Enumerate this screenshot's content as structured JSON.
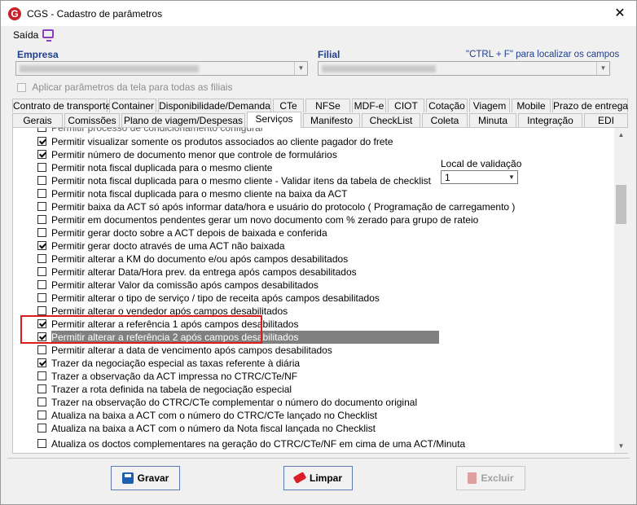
{
  "window": {
    "title": "CGS - Cadastro de parâmetros",
    "close_glyph": "✕",
    "logo_letter": "G"
  },
  "menu": {
    "saida": "Saída"
  },
  "filters": {
    "empresa_label": "Empresa",
    "filial_label": "Filial",
    "hint": "\"CTRL + F\" para localizar os campos",
    "apply_all_label": "Aplicar parâmetros da tela para todas as filiais"
  },
  "tabs_row1": [
    "Contrato de transporte",
    "Container",
    "Disponibilidade/Demanda",
    "CTe",
    "NFSe",
    "MDF-e",
    "CIOT",
    "Cotação",
    "Viagem",
    "Mobile",
    "Prazo de entrega"
  ],
  "tabs_row2": [
    "Gerais",
    "Comissões",
    "Plano de viagem/Despesas",
    "Serviços",
    "Manifesto",
    "CheckList",
    "Coleta",
    "Minuta",
    "Integração",
    "EDI"
  ],
  "active_tab": "Serviços",
  "items": [
    {
      "label": "Permitir processo de condicionamento configurar",
      "checked": false
    },
    {
      "label": "Permitir visualizar somente os produtos associados ao cliente pagador do frete",
      "checked": true
    },
    {
      "label": "Permitir número de documento menor que controle de formulários",
      "checked": true
    },
    {
      "label": "Permitir nota fiscal duplicada para o mesmo cliente",
      "checked": false
    },
    {
      "label": "Permitir nota fiscal duplicada para o mesmo cliente - Validar itens da tabela de checklist",
      "checked": false
    },
    {
      "label": "Permitir nota fiscal duplicada para o mesmo cliente na baixa da ACT",
      "checked": false
    },
    {
      "label": "Permitir baixa da ACT só após informar data/hora e usuário do protocolo ( Programação de carregamento )",
      "checked": false
    },
    {
      "label": "Permitir em documentos pendentes gerar um novo documento com % zerado para grupo de rateio",
      "checked": false
    },
    {
      "label": "Permitir gerar docto sobre a ACT depois de baixada e conferida",
      "checked": false
    },
    {
      "label": "Permitir gerar docto através de uma ACT não baixada",
      "checked": true
    },
    {
      "label": "Permitir alterar a KM do documento e/ou após campos desabilitados",
      "checked": false
    },
    {
      "label": "Permitir alterar Data/Hora prev. da entrega após campos desabilitados",
      "checked": false
    },
    {
      "label": "Permitir alterar Valor da comissão após campos desabilitados",
      "checked": false
    },
    {
      "label": "Permitir alterar o tipo de serviço / tipo de receita após campos desabilitados",
      "checked": false
    },
    {
      "label": "Permitir alterar o vendedor após campos desabilitados",
      "checked": false
    },
    {
      "label": "Permitir alterar a referência 1 após campos desabilitados",
      "checked": true
    },
    {
      "label": "Permitir alterar a referência 2 após campos desabilitados",
      "checked": true,
      "selected": true
    },
    {
      "label": "Permitir alterar a data de vencimento após campos desabilitados",
      "checked": false
    },
    {
      "label": "Trazer da negociação especial as taxas referente à diária",
      "checked": true
    },
    {
      "label": "Trazer a observação da ACT impressa no CTRC/CTe/NF",
      "checked": false
    },
    {
      "label": "Trazer a rota definida na tabela de negociação especial",
      "checked": false
    },
    {
      "label": "Trazer na observação do CTRC/CTe complementar o número do documento original",
      "checked": false
    },
    {
      "label": "Atualiza na baixa a ACT com o número do CTRC/CTe lançado no Checklist",
      "checked": false
    },
    {
      "label": "Atualiza na baixa a ACT com o número da Nota fiscal lançada no Checklist",
      "checked": false
    },
    {
      "label": "Atualiza os doctos complementares na geração do CTRC/CTe/NF em cima de uma ACT/Minuta",
      "checked": false
    }
  ],
  "local_validacao": {
    "label": "Local de validação",
    "value": "1"
  },
  "buttons": {
    "gravar": "Gravar",
    "limpar": "Limpar",
    "excluir": "Excluir"
  }
}
